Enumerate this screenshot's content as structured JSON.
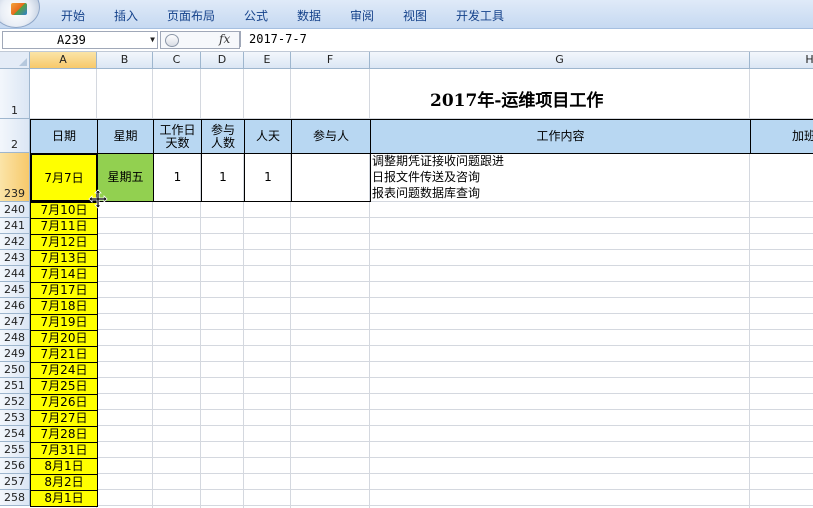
{
  "ribbon": {
    "tabs": [
      "开始",
      "插入",
      "页面布局",
      "公式",
      "数据",
      "审阅",
      "视图",
      "开发工具"
    ]
  },
  "formula_bar": {
    "name_box": "A239",
    "fx_label": "fx",
    "formula": "2017-7-7"
  },
  "columns": [
    "A",
    "B",
    "C",
    "D",
    "E",
    "F",
    "G",
    "H"
  ],
  "sheet": {
    "title": "2017年-运维项目工作",
    "headers": {
      "date": "日期",
      "weekday": "星期",
      "work_days": "工作日天数",
      "participants_count": "参与人数",
      "person_days": "人天",
      "participants": "参与人",
      "content": "工作内容",
      "overtime": "加班时"
    },
    "row_239": {
      "date": "7月7日",
      "weekday": "星期五",
      "work_days": "1",
      "participants_count": "1",
      "person_days": "1",
      "content_lines": [
        "调整期凭证接收问题跟进",
        "日报文件传送及咨询",
        "报表问题数据库查询"
      ]
    },
    "row_numbers_top": [
      "1",
      "2",
      "239"
    ],
    "dates": [
      {
        "row": "240",
        "date": "7月10日"
      },
      {
        "row": "241",
        "date": "7月11日"
      },
      {
        "row": "242",
        "date": "7月12日"
      },
      {
        "row": "243",
        "date": "7月13日"
      },
      {
        "row": "244",
        "date": "7月14日"
      },
      {
        "row": "245",
        "date": "7月17日"
      },
      {
        "row": "246",
        "date": "7月18日"
      },
      {
        "row": "247",
        "date": "7月19日"
      },
      {
        "row": "248",
        "date": "7月20日"
      },
      {
        "row": "249",
        "date": "7月21日"
      },
      {
        "row": "250",
        "date": "7月24日"
      },
      {
        "row": "251",
        "date": "7月25日"
      },
      {
        "row": "252",
        "date": "7月26日"
      },
      {
        "row": "253",
        "date": "7月27日"
      },
      {
        "row": "254",
        "date": "7月28日"
      },
      {
        "row": "255",
        "date": "7月31日"
      },
      {
        "row": "256",
        "date": "8月1日"
      },
      {
        "row": "257",
        "date": "8月2日"
      },
      {
        "row": "258",
        "date": "8月1日"
      }
    ]
  },
  "colors": {
    "header_fill": "#b8d7f2",
    "date_fill": "#ffff00",
    "weekday_fill": "#92d050",
    "ribbon_text": "#15428b"
  }
}
